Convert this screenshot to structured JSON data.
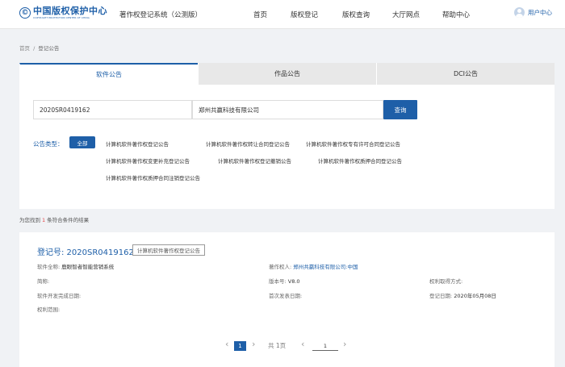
{
  "header": {
    "logo_mark": "©",
    "logo_cn": "中国版权保护中心",
    "logo_en": "COPYRIGHT PROTECTION CENTER OF CHINA",
    "system_name": "著作权登记系统（公测版）",
    "nav": [
      "首页",
      "版权登记",
      "版权查询",
      "大厅网点",
      "帮助中心"
    ],
    "user_label": "用户中心"
  },
  "breadcrumb": {
    "home": "首页",
    "sep": "/",
    "current": "登记公告"
  },
  "tabs": [
    "软件公告",
    "作品公告",
    "DCI公告"
  ],
  "search": {
    "reg_no": "2020SR0419162",
    "owner": "郑州共赢科技有限公司",
    "button": "查询"
  },
  "filters": {
    "label": "公告类型：",
    "all": "全部",
    "types": [
      "计算机软件著作权登记公告",
      "计算机软件著作权转让合同登记公告",
      "计算机软件著作权专有许可合同登记公告",
      "计算机软件著作权变更补充登记公告",
      "计算机软件著作权登记撤销公告",
      "计算机软件著作权质押合同登记公告",
      "计算机软件著作权质押合同注销登记公告"
    ]
  },
  "result_count": {
    "prefix": "为您找到",
    "count": "1",
    "suffix": "条符合条件的结果"
  },
  "result": {
    "reg_title": "登记号: 2020SR0419162",
    "tag": "计算机软件著作权登记公告",
    "software_name_label": "软件全称:",
    "software_name": "鹿眼智者智能营销系统",
    "short_name_label": "简称:",
    "dev_date_label": "软件开发完成日期:",
    "scope_label": "权利范围:",
    "owner_label": "著作权人:",
    "owner": "郑州共赢科技有限公司:中国",
    "version_label": "版本号:",
    "version": "V8.0",
    "publish_date_label": "首次发表日期:",
    "rights_way_label": "权利取得方式:",
    "reg_date_label": "登记日期:",
    "reg_date": "2020年05月08日"
  },
  "pagination": {
    "prev": "‹",
    "current": "1",
    "next": "›",
    "total": "共 1页",
    "jump_prev": "‹",
    "jump_value": "1",
    "jump_next": "›"
  }
}
